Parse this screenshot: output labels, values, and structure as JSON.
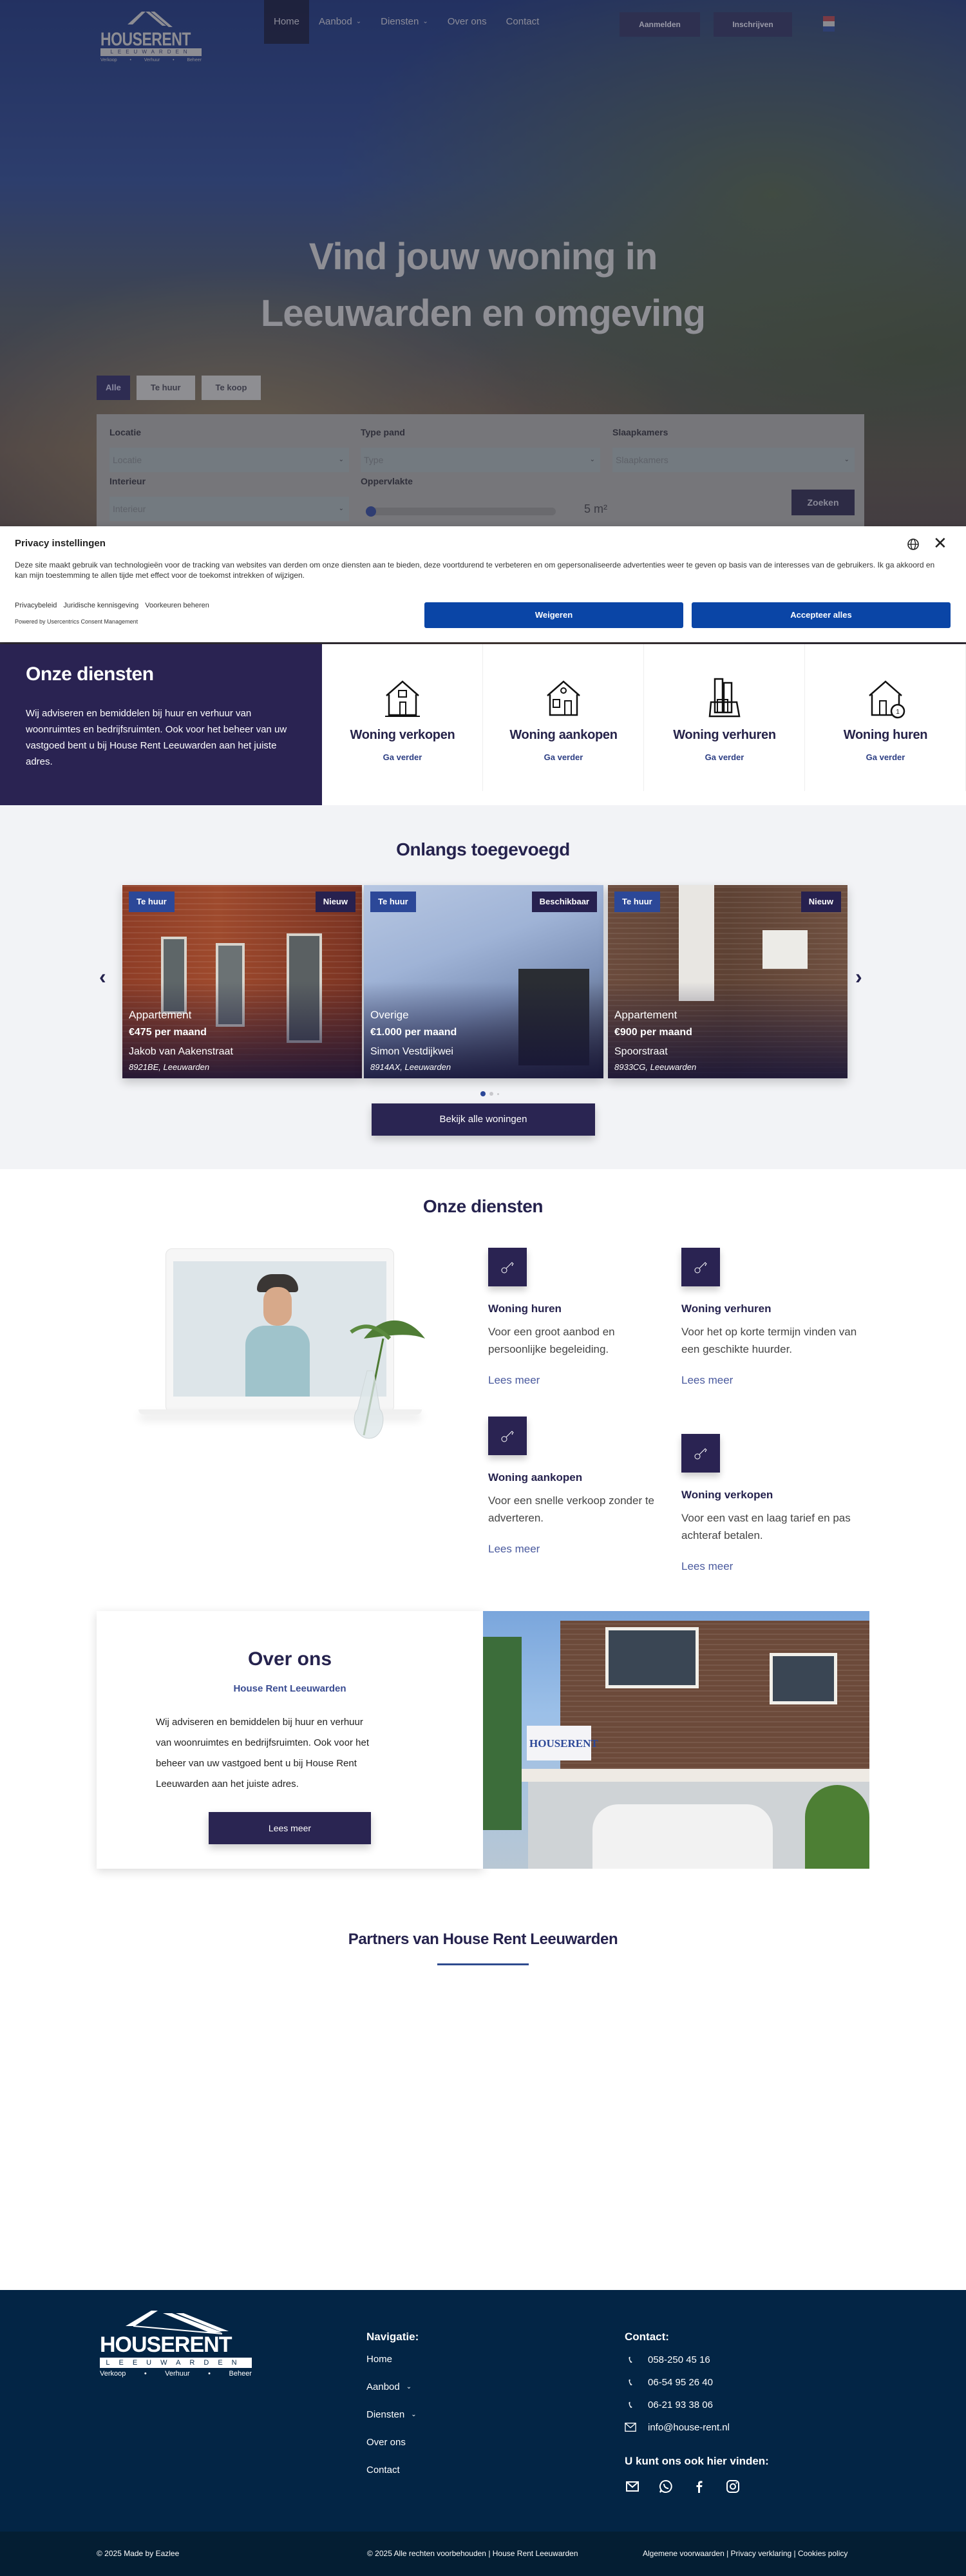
{
  "nav": {
    "logo": {
      "word": "HOUSERENT",
      "sub": "LEEUWARDEN",
      "tags": [
        "Verkoop",
        "•",
        "Verhuur",
        "•",
        "Beheer"
      ]
    },
    "items": [
      {
        "label": "Home",
        "active": true
      },
      {
        "label": "Aanbod",
        "dropdown": true
      },
      {
        "label": "Diensten",
        "dropdown": true
      },
      {
        "label": "Over ons"
      },
      {
        "label": "Contact"
      }
    ],
    "login_label": "Aanmelden",
    "register_label": "Inschrijven",
    "language_flag": "nl-flag-icon",
    "flag_colors": [
      "#ae1c28",
      "#ffffff",
      "#21468b"
    ]
  },
  "hero": {
    "title_line1": "Vind jouw woning in",
    "title_line2": "Leeuwarden en omgeving",
    "tabs": [
      {
        "label": "Alle",
        "active": true
      },
      {
        "label": "Te huur"
      },
      {
        "label": "Te koop"
      }
    ],
    "search": {
      "locatie_label": "Locatie",
      "locatie_placeholder": "Locatie",
      "type_label": "Type pand",
      "type_placeholder": "Type",
      "slaapkamers_label": "Slaapkamers",
      "slaapkamers_placeholder": "Slaapkamers",
      "interieur_label": "Interieur",
      "interieur_placeholder": "Interieur",
      "oppervlakte_label": "Oppervlakte",
      "oppervlakte_value": "5 m²",
      "oppervlakte_slider_fraction": 0,
      "submit_label": "Zoeken"
    }
  },
  "cookie": {
    "title": "Privacy instellingen",
    "text": "Deze site maakt gebruik van technologieën voor de tracking van websites van derden om onze diensten aan te bieden, deze voortdurend te verbeteren en om gepersonaliseerde advertenties weer te geven op basis van de interesses van de gebruikers. Ik ga akkoord en kan mijn toestemming te allen tijde met effect voor de toekomst intrekken of wijzigen.",
    "links": [
      "Privacybeleid",
      "Juridische kennisgeving",
      "Voorkeuren beheren"
    ],
    "powered": "Powered by Usercentrics Consent Management",
    "deny_label": "Weigeren",
    "accept_label": "Accepteer alles",
    "button_color": "#0a45a6"
  },
  "services_strip": {
    "title": "Onze diensten",
    "text": "Wij adviseren en bemiddelen bij huur en verhuur van woonruimtes en bedrijfsruimten. Ook voor het beheer van uw vastgoed bent u bij House Rent Leeuwarden aan het juiste adres.",
    "cards": [
      {
        "icon": "house-sell-icon",
        "title": "Woning verkopen",
        "link": "Ga verder"
      },
      {
        "icon": "house-buy-icon",
        "title": "Woning aankopen",
        "link": "Ga verder"
      },
      {
        "icon": "buildings-icon",
        "title": "Woning verhuren",
        "link": "Ga verder"
      },
      {
        "icon": "house-clock-icon",
        "title": "Woning huren",
        "link": "Ga verder"
      }
    ]
  },
  "recent": {
    "title": "Onlangs toegevoegd",
    "listings": [
      {
        "badge_left": "Te huur",
        "badge_right": "Nieuw",
        "type": "Appartement",
        "price": "€475 per maand",
        "street": "Jakob van Aakenstraat",
        "zip": "8921BE, Leeuwarden"
      },
      {
        "badge_left": "Te huur",
        "badge_right": "Beschikbaar",
        "type": "Overige",
        "price": "€1.000 per maand",
        "street": "Simon Vestdijkwei",
        "zip": "8914AX, Leeuwarden"
      },
      {
        "badge_left": "Te huur",
        "badge_right": "Nieuw",
        "type": "Appartement",
        "price": "€900 per maand",
        "street": "Spoorstraat",
        "zip": "8933CG, Leeuwarden"
      }
    ],
    "prev_icon": "‹",
    "next_icon": "›",
    "pagination_active": 1,
    "button_label": "Bekijk alle woningen"
  },
  "services": {
    "title": "Onze diensten",
    "items": [
      {
        "title": "Woning huren",
        "text": "Voor een groot aanbod en persoonlijke begeleiding.",
        "link": "Lees meer"
      },
      {
        "title": "Woning verhuren",
        "text": "Voor het op korte termijn vinden van een geschikte huurder.",
        "link": "Lees meer"
      },
      {
        "title": "Woning aankopen",
        "text": "Voor een snelle verkoop zonder te adverteren.",
        "link": "Lees meer"
      },
      {
        "title": "Woning verkopen",
        "text": "Voor een vast en laag tarief en pas achteraf betalen.",
        "link": "Lees meer"
      }
    ]
  },
  "about": {
    "title": "Over ons",
    "subtitle": "House Rent Leeuwarden",
    "text": "Wij adviseren en bemiddelen bij huur en verhuur van woonruimtes en bedrijfsruimten.  Ook voor het beheer van uw vastgoed bent u bij House Rent Leeuwarden aan het juiste adres.",
    "button_label": "Lees meer",
    "photo_sign": "HOUSERENT"
  },
  "partners": {
    "title": "Partners van House Rent Leeuwarden"
  },
  "footer": {
    "nav_title": "Navigatie:",
    "nav_items": [
      {
        "label": "Home"
      },
      {
        "label": "Aanbod",
        "dropdown": true
      },
      {
        "label": "Diensten",
        "dropdown": true
      },
      {
        "label": "Over ons"
      },
      {
        "label": "Contact"
      }
    ],
    "contact_title": "Contact:",
    "phones": [
      "058-250 45 16",
      "06-54 95 26 40",
      "06-21 93 38 06"
    ],
    "email": "info@house-rent.nl",
    "social_title": "U kunt ons ook hier vinden:",
    "social": [
      "mail-icon",
      "whatsapp-icon",
      "facebook-icon",
      "instagram-icon"
    ],
    "made_by": "© 2025 Made by Eazlee",
    "rights": "© 2025 Alle rechten voorbehouden | House Rent Leeuwarden",
    "legal": "Algemene voorwaarden | Privacy verklaring | Cookies policy"
  },
  "colors": {
    "brand_dark": "#2a2352",
    "brand_blue": "#2c4898",
    "footer_bg": "#032545"
  }
}
